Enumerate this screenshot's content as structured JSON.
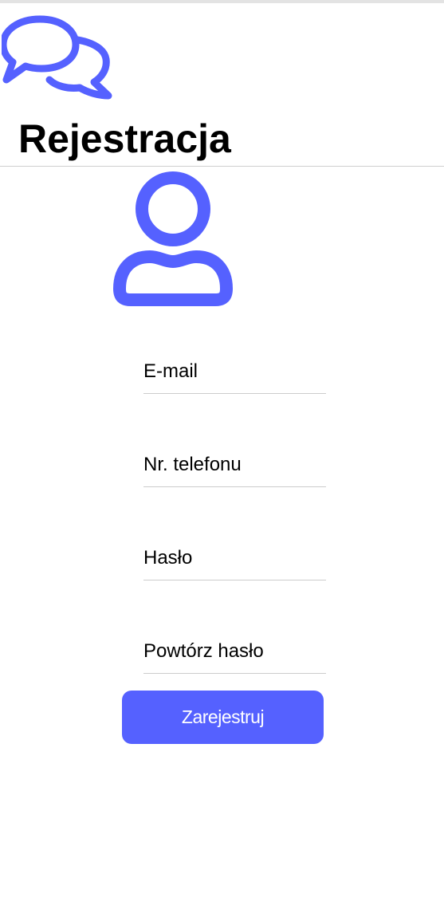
{
  "header": {
    "logo_icon": "chat-bubbles-icon",
    "title": "Rejestracja"
  },
  "avatar": {
    "icon": "user-icon"
  },
  "form": {
    "email_placeholder": "E-mail",
    "phone_placeholder": "Nr. telefonu",
    "password_placeholder": "Hasło",
    "password_repeat_placeholder": "Powtórz hasło",
    "submit_label": "Zarejestruj"
  },
  "colors": {
    "accent": "#5561ff",
    "divider": "#cfcfcf",
    "text": "#000000",
    "background": "#ffffff"
  }
}
